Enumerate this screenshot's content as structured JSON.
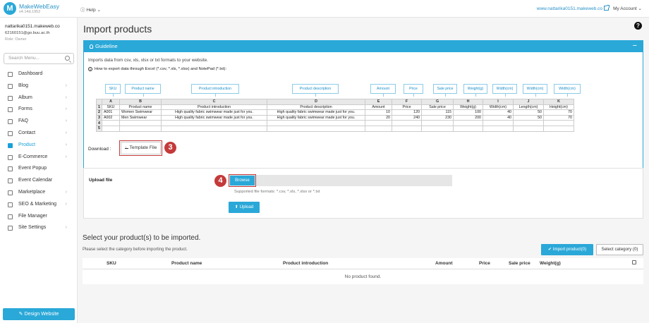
{
  "topbar": {
    "brand_name": "MakeWebEasy",
    "brand_version": "v4.14d.1952",
    "help_label": "Help",
    "site_url": "www.nattarika0151.makeweb.co",
    "account_label": "My Account"
  },
  "sidebar": {
    "user_name": "nattarika0151.makeweb.co",
    "user_email": "62160151@go.buu.ac.th",
    "user_role": "Role: Owner",
    "search_placeholder": "Search Menu...",
    "items": [
      {
        "label": "Dashboard",
        "icon": "home-icon",
        "chevron": ""
      },
      {
        "label": "Blog",
        "icon": "blog-icon",
        "chevron": "›"
      },
      {
        "label": "Album",
        "icon": "album-icon",
        "chevron": "›"
      },
      {
        "label": "Forms",
        "icon": "forms-icon",
        "chevron": "›"
      },
      {
        "label": "FAQ",
        "icon": "faq-icon",
        "chevron": "›"
      },
      {
        "label": "Contact",
        "icon": "contact-icon",
        "chevron": "›"
      },
      {
        "label": "Product",
        "icon": "product-icon",
        "chevron": "›"
      },
      {
        "label": "E-Commerce",
        "icon": "tag-icon",
        "chevron": "›"
      },
      {
        "label": "Event Popup",
        "icon": "popup-icon",
        "chevron": ""
      },
      {
        "label": "Event Calendar",
        "icon": "calendar-icon",
        "chevron": ""
      },
      {
        "label": "Marketplace",
        "icon": "marketplace-icon",
        "chevron": "›"
      },
      {
        "label": "SEO & Marketing",
        "icon": "seo-icon",
        "chevron": "›"
      },
      {
        "label": "File Manager",
        "icon": "folder-icon",
        "chevron": ""
      },
      {
        "label": "Site Settings",
        "icon": "gear-icon",
        "chevron": "›"
      }
    ],
    "active_index": 6,
    "design_button": "Design Website"
  },
  "main": {
    "page_title": "Import products",
    "guideline": {
      "title": "Guideline",
      "collapse_symbol": "−",
      "intro": "Imports data from csv, xls, xlsx or txt formats to your website.",
      "how_to": "How to export data through Excel (*.csv, *.xls, *.xlsx) and NotePad (*.txt):",
      "field_tags": [
        "SKU",
        "Product name",
        "Product introduction",
        "Product description",
        "Amount",
        "Price",
        "Sale price",
        "Weight(g)",
        "Width(cm)",
        "Width(cm)",
        "Width(cm)"
      ],
      "sheet": {
        "letters": [
          "A",
          "B",
          "C",
          "D",
          "E",
          "F",
          "G",
          "H",
          "I",
          "J",
          "K",
          "L"
        ],
        "rows": [
          [
            "1",
            "SKU",
            "Product name",
            "Product introduction",
            "Product description",
            "Amount",
            "Price",
            "Sale price",
            "Weight(g)",
            "Width(cm)",
            "Length(cm)",
            "Height(cm)"
          ],
          [
            "2",
            "A001",
            "Women Swimwear",
            "High quality fabric swimwear made just for you.",
            "High quality fabric swimwear made just for you.",
            "10",
            "120",
            "115",
            "100",
            "40",
            "50",
            "70"
          ],
          [
            "3",
            "A002",
            "Men Swimwear",
            "High quality fabric swimwear made just for you.",
            "High quality fabric swimwear made just for you.",
            "20",
            "240",
            "230",
            "200",
            "40",
            "50",
            "70"
          ],
          [
            "4",
            "",
            "",
            "",
            "",
            "",
            "",
            "",
            "",
            "",
            "",
            ""
          ],
          [
            "5",
            "",
            "",
            "",
            "",
            "",
            "",
            "",
            "",
            "",
            "",
            ""
          ]
        ]
      },
      "download_label": "Download :",
      "template_button": "Template File",
      "callout_3": "3"
    },
    "upload": {
      "label": "Upload file",
      "browse_button": "Browse",
      "formats": "Supported file formats: *.csv, *.xls, *.xlsx or *.txt",
      "upload_button": "Upload",
      "callout_4": "4"
    },
    "select": {
      "title": "Select your product(s) to be imported.",
      "note": "Please select the category before importing the product.",
      "import_button": "Import product(0)",
      "category_button": "Select category (0)",
      "columns": [
        "",
        "SKU",
        "Product name",
        "Product introduction",
        "Amount",
        "Price",
        "Sale price",
        "Weight(g)"
      ],
      "empty_message": "No product found."
    }
  },
  "colors": {
    "accent": "#2aa8d8",
    "callout": "#c43a3a"
  }
}
